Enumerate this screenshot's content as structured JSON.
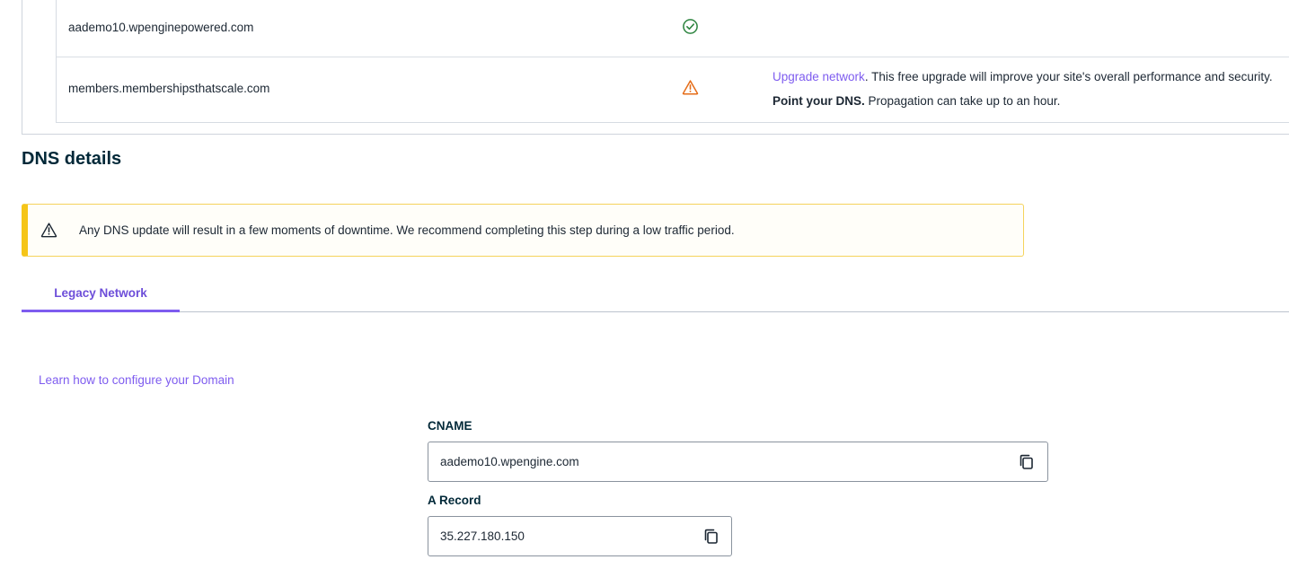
{
  "domains": [
    {
      "name": "aademo10.wpenginepowered.com",
      "status_icon": "check-circle-icon",
      "status_color": "#2e8540"
    },
    {
      "name": "members.membershipsthatscale.com",
      "status_icon": "warning-triangle-icon",
      "status_color": "#e56d19",
      "message_link": "Upgrade network",
      "message_text": ". This free upgrade will improve your site's overall performance and security.",
      "dns_bold": "Point your DNS.",
      "dns_text": " Propagation can take up to an hour."
    }
  ],
  "dns_details": {
    "title": "DNS details",
    "alert_text": "Any DNS update will result in a few moments of downtime. We recommend completing this step during a low traffic period.",
    "alert_icon": "warning-triangle-icon",
    "tabs": [
      {
        "label": "Legacy Network",
        "active": true
      }
    ],
    "learn_link": "Learn how to configure your Domain",
    "cname_label": "CNAME",
    "cname_value": "aademo10.wpengine.com",
    "arecord_label": "A Record",
    "arecord_value": "35.227.180.150",
    "copy_icon": "copy-icon"
  },
  "colors": {
    "accent": "#7e5cef",
    "alert_border": "#f5c518",
    "heading": "#002838"
  }
}
